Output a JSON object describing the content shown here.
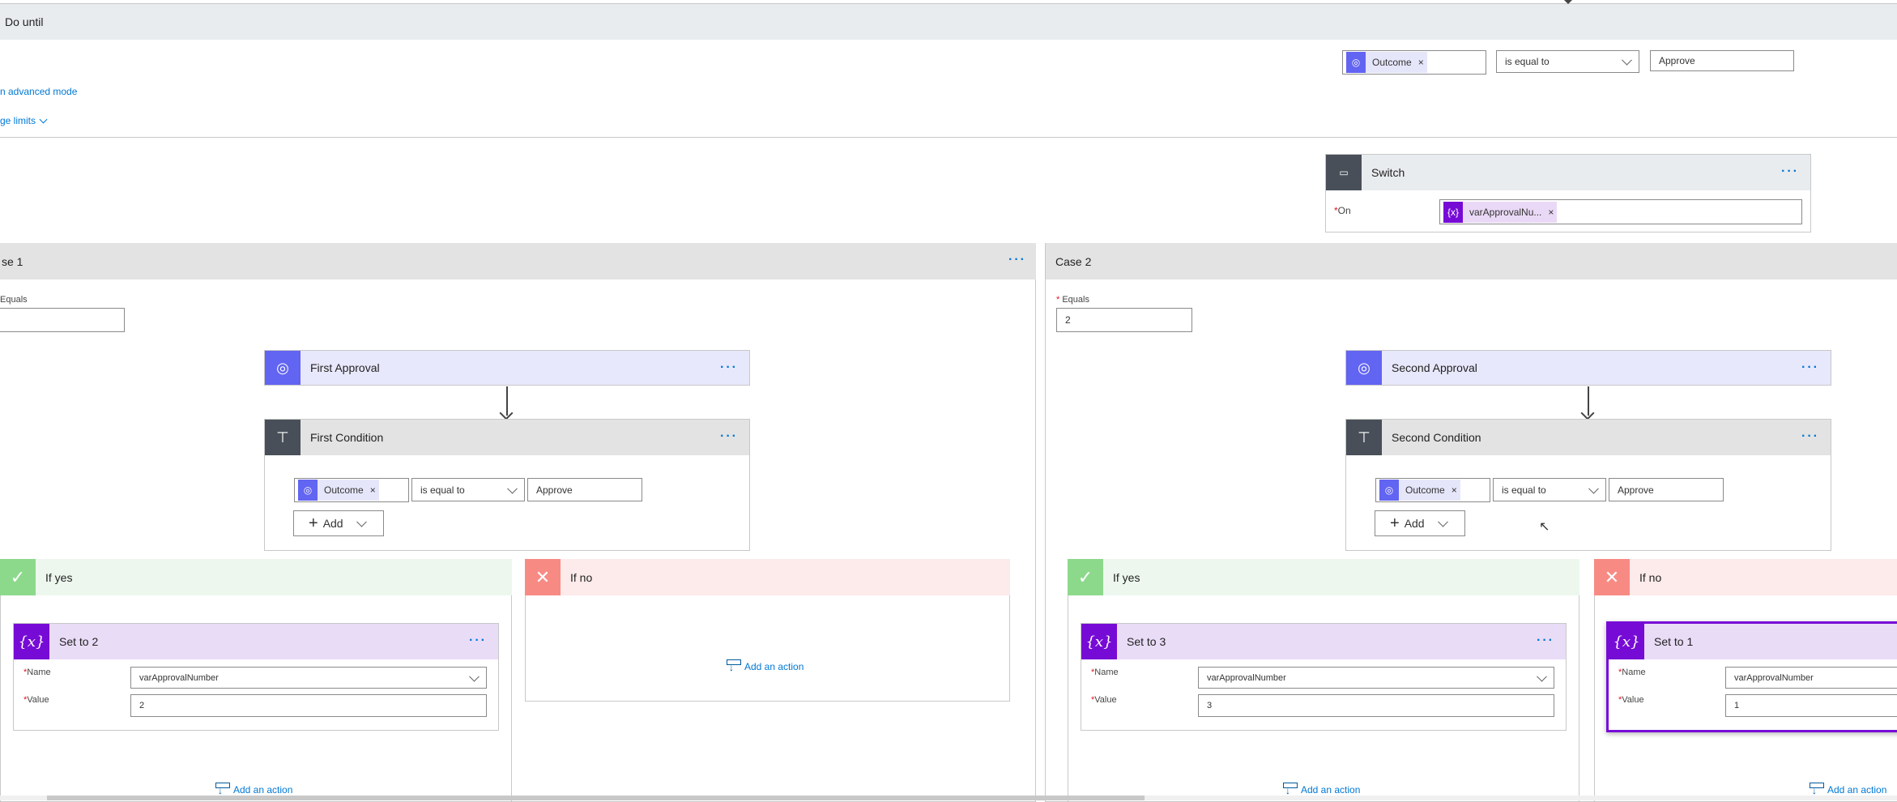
{
  "do_until": {
    "title": "Do until",
    "advanced_link": "n advanced mode",
    "limits_link": "ge limits",
    "condition": {
      "token": "Outcome",
      "operator": "is equal to",
      "value": "Approve"
    }
  },
  "switch": {
    "title": "Switch",
    "on_label": "On",
    "on_token": "varApprovalNu..."
  },
  "cases": [
    {
      "title": "se 1",
      "equals_label": "Equals",
      "equals_value": "",
      "approval": "First Approval",
      "condition": "First Condition",
      "cond_token": "Outcome",
      "cond_operator": "is equal to",
      "cond_value": "Approve",
      "add_label": "Add",
      "if_yes": {
        "title": "If yes",
        "set": {
          "title": "Set to 2",
          "name_label": "Name",
          "name_value": "varApprovalNumber",
          "value_label": "Value",
          "value_value": "2"
        },
        "add_action": "Add an action"
      },
      "if_no": {
        "title": "If no",
        "add_action": "Add an action"
      }
    },
    {
      "title": "Case 2",
      "equals_label": "Equals",
      "equals_value": "2",
      "approval": "Second Approval",
      "condition": "Second Condition",
      "cond_token": "Outcome",
      "cond_operator": "is equal to",
      "cond_value": "Approve",
      "add_label": "Add",
      "if_yes": {
        "title": "If yes",
        "set": {
          "title": "Set to 3",
          "name_label": "Name",
          "name_value": "varApprovalNumber",
          "value_label": "Value",
          "value_value": "3"
        },
        "add_action": "Add an action"
      },
      "if_no": {
        "title": "If no",
        "set": {
          "title": "Set to 1",
          "name_label": "Name",
          "name_value": "varApprovalNumber",
          "value_label": "Value",
          "value_value": "1"
        },
        "add_action": "Add an action"
      }
    }
  ],
  "colors": {
    "approval": "#6264f2",
    "condition": "#484f58",
    "variable": "#770bd6",
    "yes": "#8cd98c",
    "no": "#f88a84",
    "link": "#0078d4"
  }
}
